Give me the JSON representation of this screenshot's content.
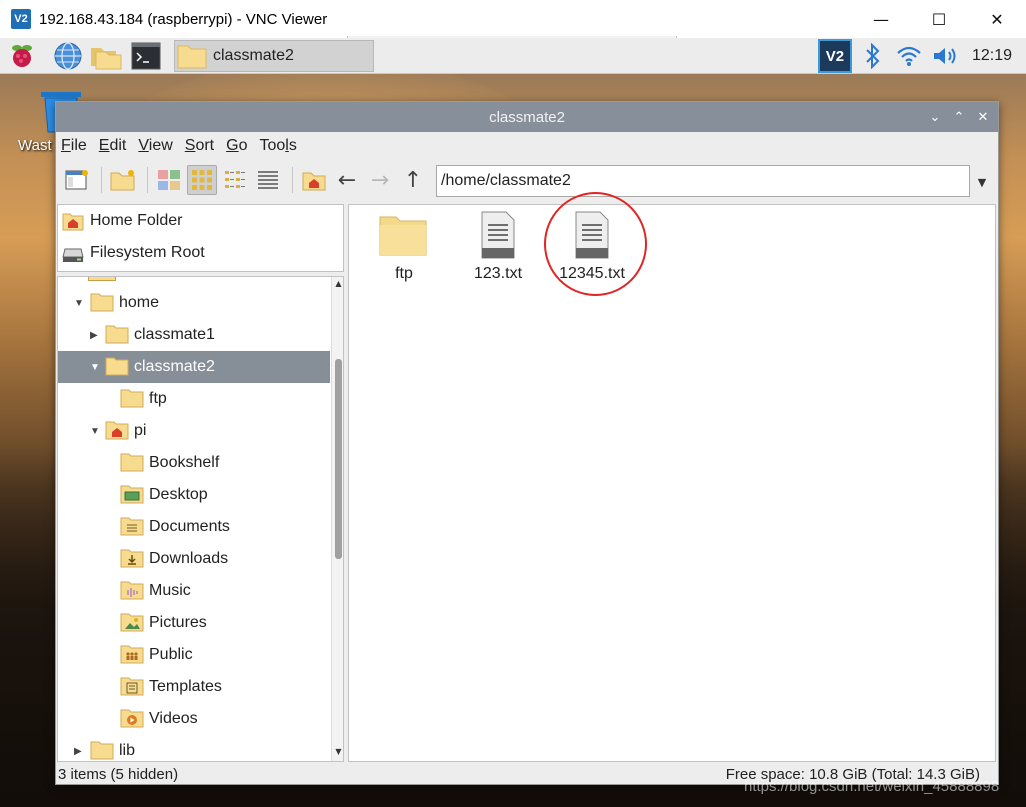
{
  "vnc": {
    "title": "192.168.43.184 (raspberrypi) - VNC Viewer",
    "logo": "V2",
    "minimize": "—",
    "maximize": "☐",
    "close": "✕"
  },
  "panel": {
    "task_label": "classmate2",
    "vnc_logo": "V2",
    "clock": "12:19",
    "icons": [
      "raspberry-menu-icon",
      "web-browser-icon",
      "file-manager-icon",
      "terminal-icon",
      "bluetooth-icon",
      "wifi-icon",
      "volume-icon"
    ]
  },
  "desktop": {
    "wastebasket_label": "Wast"
  },
  "window": {
    "title": "classmate2",
    "controls": [
      "⌄",
      "⌃",
      "✕"
    ]
  },
  "menubar": [
    {
      "mnemonic": "F",
      "rest": "ile"
    },
    {
      "mnemonic": "E",
      "rest": "dit"
    },
    {
      "mnemonic": "V",
      "rest": "iew"
    },
    {
      "mnemonic": "S",
      "rest": "ort"
    },
    {
      "mnemonic": "G",
      "rest": "o"
    },
    {
      "pre": "Too",
      "mnemonic": "l",
      "rest": "s"
    }
  ],
  "toolbar": {
    "path": "/home/classmate2",
    "dropdown": "▼",
    "back": "←",
    "forward": "→",
    "up": "↑"
  },
  "places": [
    {
      "label": "Home Folder",
      "icon": "home-folder-icon"
    },
    {
      "label": "Filesystem Root",
      "icon": "drive-icon"
    }
  ],
  "tree": [
    {
      "label": "home",
      "expander": "▼",
      "icon": "folder"
    },
    {
      "label": "classmate1",
      "expander": "▶",
      "icon": "folder"
    },
    {
      "label": "classmate2",
      "expander": "▼",
      "icon": "folder",
      "selected": true
    },
    {
      "label": "ftp",
      "expander": "",
      "icon": "folder"
    },
    {
      "label": "pi",
      "expander": "▼",
      "icon": "home-folder"
    },
    {
      "label": "Bookshelf",
      "expander": "",
      "icon": "folder"
    },
    {
      "label": "Desktop",
      "expander": "",
      "icon": "desktop-folder"
    },
    {
      "label": "Documents",
      "expander": "",
      "icon": "documents-folder"
    },
    {
      "label": "Downloads",
      "expander": "",
      "icon": "downloads-folder"
    },
    {
      "label": "Music",
      "expander": "",
      "icon": "music-folder"
    },
    {
      "label": "Pictures",
      "expander": "",
      "icon": "pictures-folder"
    },
    {
      "label": "Public",
      "expander": "",
      "icon": "public-folder"
    },
    {
      "label": "Templates",
      "expander": "",
      "icon": "templates-folder"
    },
    {
      "label": "Videos",
      "expander": "",
      "icon": "videos-folder"
    },
    {
      "label": "lib",
      "expander": "▶",
      "icon": "folder"
    }
  ],
  "files": [
    {
      "name": "ftp",
      "type": "folder"
    },
    {
      "name": "123.txt",
      "type": "text"
    },
    {
      "name": "12345.txt",
      "type": "text",
      "circled": true
    }
  ],
  "status": {
    "left": "3 items (5 hidden)",
    "right": "Free space: 10.8 GiB (Total: 14.3 GiB)"
  },
  "watermark": "https://blog.csdn.net/weixin_45888898",
  "colors": {
    "selection": "#868f98",
    "titlebar": "#87909a",
    "folder": "#f5d98a",
    "annotation": "#e02525"
  }
}
